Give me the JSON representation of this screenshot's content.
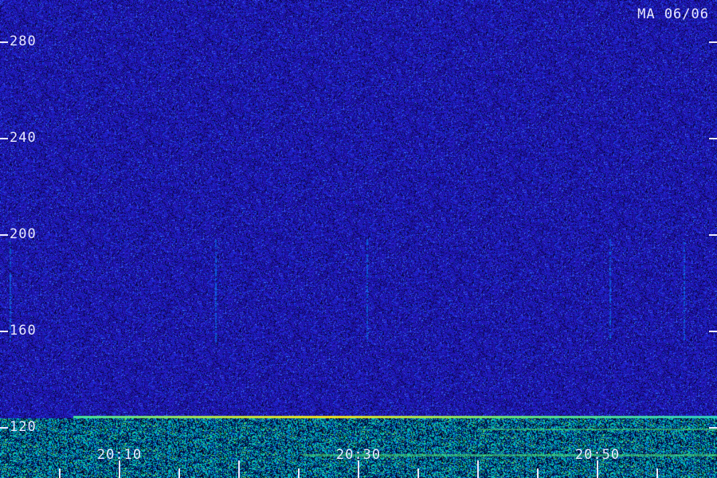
{
  "chart_data": {
    "type": "heatmap",
    "title": "MA 06/06",
    "xlabel": "",
    "ylabel": "",
    "y_ticks": [
      280,
      240,
      200,
      160,
      120
    ],
    "x_tick_labels": [
      "20:10",
      "20:30",
      "20:50"
    ],
    "ylim": [
      110,
      290
    ],
    "colormap": [
      "#0c0870",
      "#1a12b0",
      "#00a0ff",
      "#00e0a0",
      "#f0e020"
    ],
    "features": [
      {
        "kind": "horizontal-line",
        "y": 120,
        "color": "#f0e020"
      },
      {
        "kind": "dense-band",
        "y_range": [
          110,
          122
        ],
        "colors": [
          "#00e0a0",
          "#00a0ff"
        ]
      }
    ]
  },
  "colors": {
    "background": "#120c8c",
    "label": "#e8e8ff"
  }
}
